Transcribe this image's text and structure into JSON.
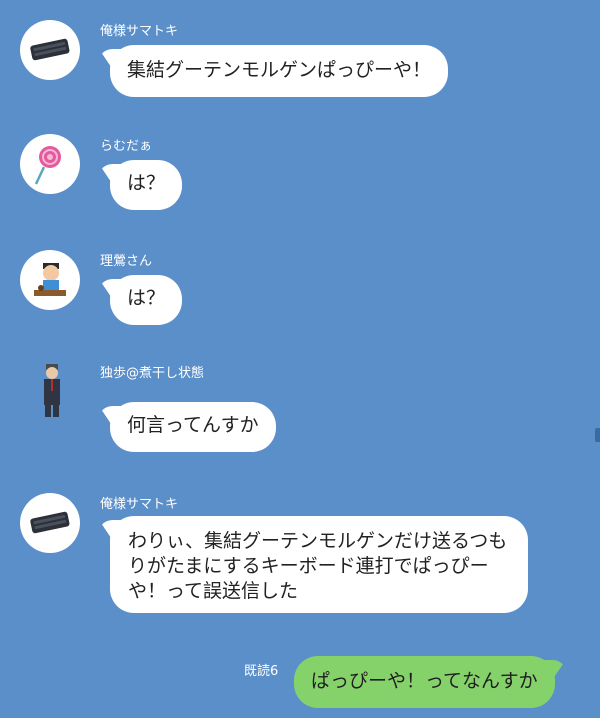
{
  "messages": [
    {
      "sender": "俺様サマトキ",
      "text": "集結グーテンモルゲンぱっぴーや！",
      "avatar_icon": "keyboard-icon"
    },
    {
      "sender": "らむだぁ",
      "text": "は？",
      "avatar_icon": "lollipop-icon"
    },
    {
      "sender": "理鶯さん",
      "text": "は？",
      "avatar_icon": "person-eating-icon"
    },
    {
      "sender": "独歩@煮干し状態",
      "text": "何言ってんすか",
      "avatar_icon": "businessman-icon"
    },
    {
      "sender": "俺様サマトキ",
      "text": "わりぃ、集結グーテンモルゲンだけ送るつもりがたまにするキーボード連打でぱっぴーや！って誤送信した",
      "avatar_icon": "keyboard-icon"
    }
  ],
  "outgoing": {
    "read_receipt": "既読6",
    "text": "ぱっぴーや！ってなんすか"
  },
  "colors": {
    "background": "#5b8fca",
    "incoming_bubble": "#ffffff",
    "outgoing_bubble": "#86d26a"
  }
}
